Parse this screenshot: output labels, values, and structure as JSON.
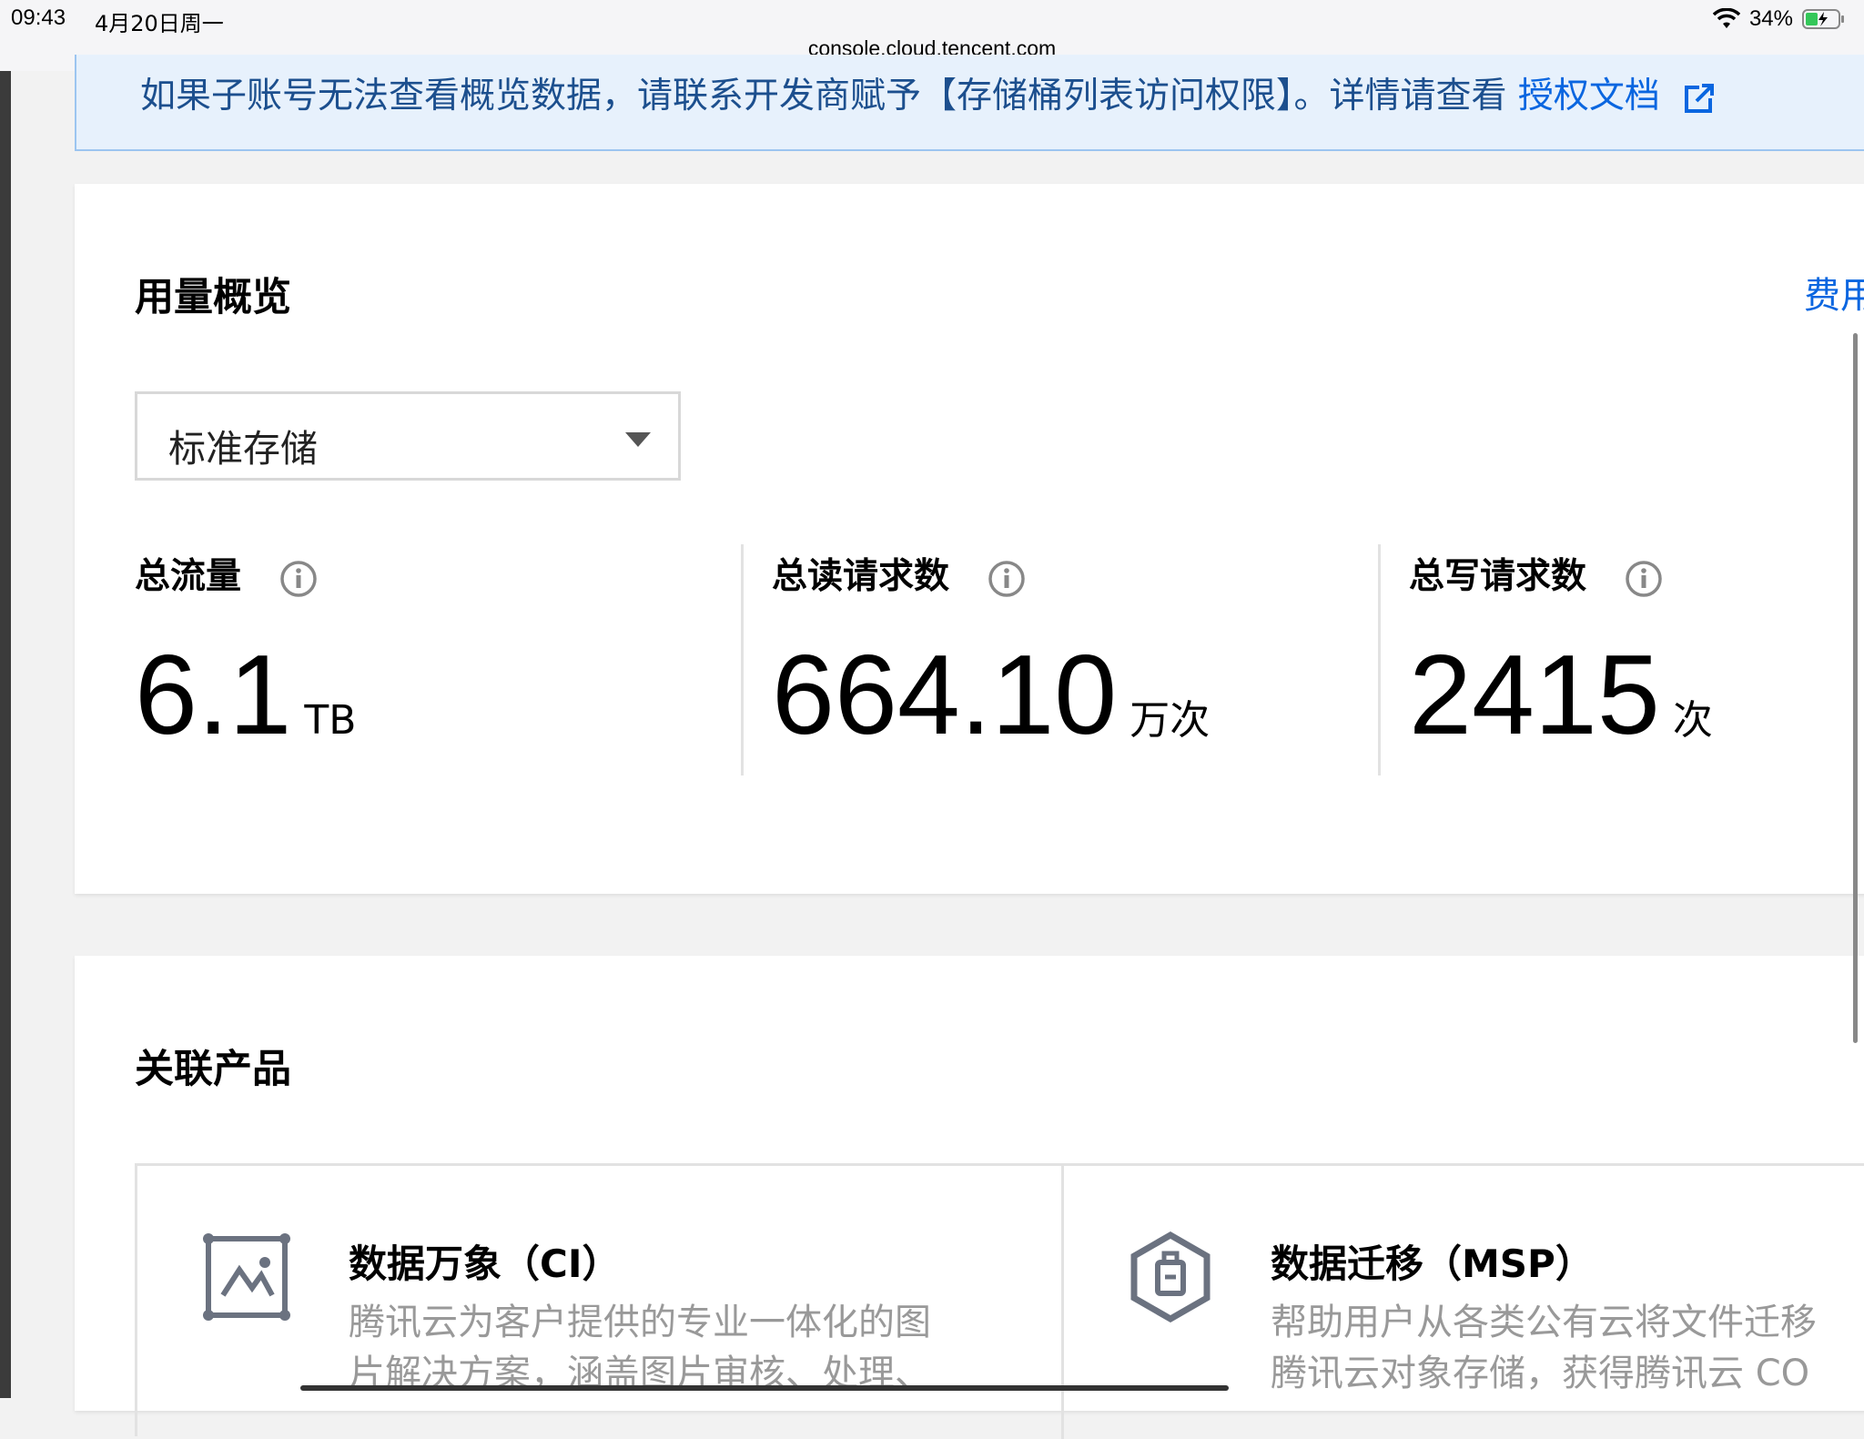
{
  "status_bar": {
    "time": "09:43",
    "date": "4月20日周一",
    "battery": "34%"
  },
  "browser": {
    "url": "console.cloud.tencent.com"
  },
  "banner": {
    "text": "如果子账号无法查看概览数据，请联系开发商赋予【存储桶列表访问权限】。详情请查看",
    "link_label": "授权文档"
  },
  "usage": {
    "title": "用量概览",
    "fee_link": "费用",
    "storage_select": {
      "value": "标准存储"
    },
    "metrics": [
      {
        "label": "总流量",
        "value": "6.1",
        "unit": "TB"
      },
      {
        "label": "总读请求数",
        "value": "664.10",
        "unit": "万次"
      },
      {
        "label": "总写请求数",
        "value": "2415",
        "unit": "次"
      }
    ]
  },
  "related": {
    "title": "关联产品",
    "products": [
      {
        "title": "数据万象（CI）",
        "desc_line1": "腾讯云为客户提供的专业一体化的图",
        "desc_line2": "片解决方案，涵盖图片审核、处理、"
      },
      {
        "title": "数据迁移（MSP）",
        "desc_line1": "帮助用户从各类公有云将文件迁移",
        "desc_line2": "腾讯云对象存储，获得腾讯云 CO"
      }
    ]
  },
  "colors": {
    "link": "#0a66e0",
    "banner_bg": "#e7f1fc",
    "banner_text": "#1c4f8e"
  }
}
